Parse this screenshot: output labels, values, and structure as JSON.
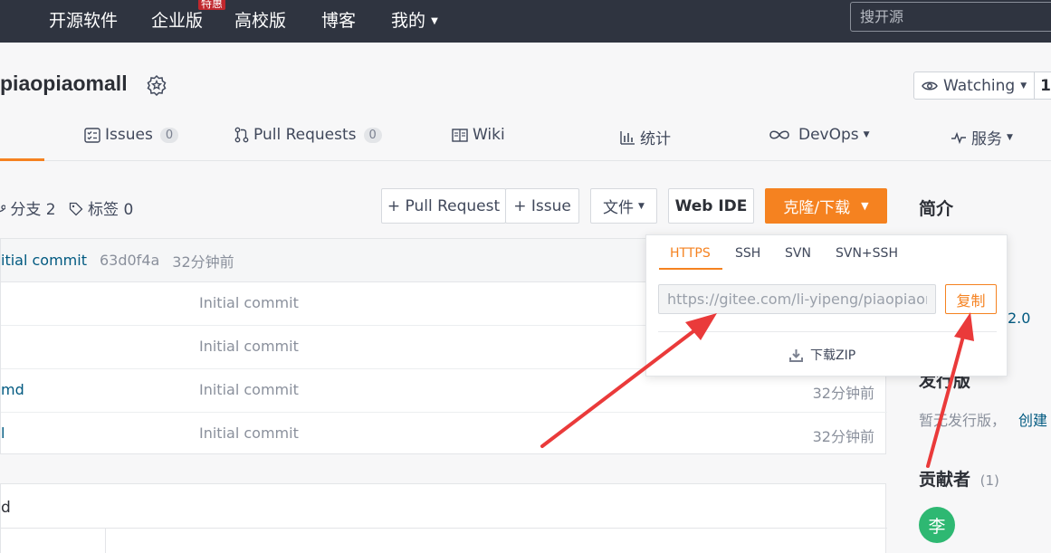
{
  "topnav": {
    "items": [
      "开源软件",
      "企业版",
      "高校版",
      "博客",
      "我的"
    ],
    "badge": "特惠",
    "search_placeholder": "搜开源"
  },
  "repo": {
    "name": "piaopiaomall",
    "watch_label": "Watching",
    "watch_count": "1"
  },
  "tabs": [
    {
      "label": "Issues",
      "count": "0"
    },
    {
      "label": "Pull Requests",
      "count": "0"
    },
    {
      "label": "Wiki"
    },
    {
      "label": "统计"
    },
    {
      "label": "DevOps"
    },
    {
      "label": "服务"
    }
  ],
  "toolbar": {
    "branches": "分支 2",
    "tags": "标签 0",
    "pull_request": "+ Pull Request",
    "issue": "+ Issue",
    "file": "文件",
    "web_ide": "Web IDE",
    "clone": "克隆/下载"
  },
  "latest_commit": {
    "message": "itial commit",
    "hash": "63d0f4a",
    "time": "32分钟前"
  },
  "files": [
    {
      "name": "",
      "message": "Initial commit",
      "time": ""
    },
    {
      "name": "",
      "message": "Initial commit",
      "time": ""
    },
    {
      "name": "md",
      "message": "Initial commit",
      "time": "32分钟前"
    },
    {
      "name": "l",
      "message": "Initial commit",
      "time": "32分钟前"
    }
  ],
  "readme_title": "d",
  "sidebar": {
    "intro_heading": "简介",
    "license_fragment": "2.0",
    "release_heading": "发行版",
    "release_text": "暂无发行版，",
    "release_create": "创建",
    "contrib_heading": "贡献者",
    "contrib_count": "(1)",
    "avatar_initial": "李"
  },
  "clone_popup": {
    "protocols": [
      "HTTPS",
      "SSH",
      "SVN",
      "SVN+SSH"
    ],
    "active": "HTTPS",
    "url": "https://gitee.com/li-yipeng/piaopiaomall.git",
    "copy": "复制",
    "download_zip": "下载ZIP"
  },
  "colors": {
    "nav_bg": "#2f3440",
    "accent": "#f58220",
    "link": "#005980",
    "annotation_arrow": "#ea3a3a"
  }
}
